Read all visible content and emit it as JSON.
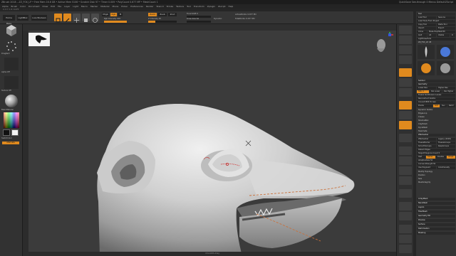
{
  "window": {
    "title": "ZBrush 2018   ...ZZ_FOX_LP   • Free Mem 16.6 GB • Active Mem 5106 • Scratch Disk 97 • Timer 0.009 • PolyCount 0.677 MP • MeshCount 1",
    "right_items": "QuickSave   See-through 0   Menus   DefaultZScript"
  },
  "menubar": [
    "Alpha",
    "Brush",
    "Color",
    "Document",
    "Draw",
    "Edit",
    "File",
    "Layer",
    "Light",
    "Macro",
    "Marker",
    "Material",
    "Movie",
    "Picker",
    "Preferences",
    "Render",
    "Stencil",
    "Stroke",
    "Texture",
    "Tool",
    "Transform",
    "Zplugin",
    "Zscript",
    "Help"
  ],
  "status_line": "X: 0 Y: 1   Z: 0.475",
  "shelf": {
    "home_page": "Home Page",
    "lightbox": "LightBox",
    "live_boolean": "Live Boolean",
    "edit": "Edit",
    "draw": "Draw",
    "move": "Move",
    "scale": "Scale",
    "rotate": "Rotate",
    "mrgb": "Mrgb",
    "rgb": "Rgb",
    "m": "M",
    "zadd": "Zadd",
    "zsub": "Zsub",
    "zcut": "Zcut",
    "rgb_intensity": "Rgb Intensity 100",
    "z_intensity": "Z Intensity 25",
    "rgb_intensity_value": 1.0,
    "z_intensity_value": 0.25,
    "focal_shift": "Focal Shift 0",
    "draw_size": "Draw Size 64",
    "dynamic": "Dynamic",
    "active_points": "ActivePoints: 0.677 Mil",
    "total_points": "TotalPoints: 0.677 Mil"
  },
  "left_tray": {
    "alpha_label": "Alpha Off",
    "texture_label": "Texture Off",
    "material_label": "BasicMaterial",
    "stroke_label": "DragRect",
    "gradient_label": "Gradient",
    "switch_color": "SwitchColor",
    "alternate": "Alternate"
  },
  "canvas": {
    "bottom_hint": "Ctrl+Shift+Drag"
  },
  "right_shelf": [
    "BPR",
    "SPix 3",
    "Scroll",
    "Zoom",
    "Actual",
    "AAHalf",
    "Persp",
    "Floor",
    "Local",
    "LSym",
    "Xyz",
    "Frame",
    "Move",
    "Scale",
    "Rotate",
    "Line Fill",
    "PolyF",
    "Transp",
    "Ghost",
    "Solo",
    "Xpose"
  ],
  "tool_tray": {
    "header": "Tool",
    "load_tool": "Load Tool",
    "save_as": "Save As",
    "load_tools_from_project": "Load Tools From Project",
    "copy_tool": "Copy Tool",
    "paste_tool": "Paste Tool",
    "import": "Import",
    "export": "Export",
    "clone": "Clone",
    "make_polymesh3d": "Make PolyMesh3D",
    "goz": "GoZ",
    "all": "All",
    "visible": "Visible",
    "r": "R",
    "lightbox_tools": "Lightbox▸Tools",
    "tool_name": "ZZ_FOX_LP. 48",
    "subtool": "Subtool",
    "geometry": "Geometry",
    "lower_res": "Lower Res",
    "higher_res": "Higher Res",
    "sdiv": "SDiv 1",
    "del_lower": "Del Lower",
    "del_higher": "Del Higher",
    "freeze_subdivision": "Freeze SubDivision Levels",
    "reconstruct_subdiv": "Reconstruct Subdiv",
    "convert_bpr": "Convert BPR To Geo",
    "divide": "Divide",
    "smt": "Smt",
    "suv": "Suv",
    "reuv": "ReUV",
    "dynamic_subdiv": "Dynamic Subdiv",
    "edgeloop": "EdgeLoop",
    "crease": "Crease",
    "shadowbox": "ShadowBox",
    "claypolish": "ClayPolish",
    "dynamesh": "DynaMesh",
    "tessimate": "Tessimate",
    "zremesher": "ZRemesher",
    "zremesher_btn": "ZRemesher",
    "legacy": "Legacy (2018)",
    "freeze_border": "FreezeBorder",
    "freeze_groups": "FreezeGroups",
    "smooth_groups": "SmoothGroups",
    "keep_groups": "KeepGroups",
    "detect_edges": "Detect Edges",
    "target_polygons": "Target Polygons Count 5",
    "half": "Half",
    "same": "Same",
    "double": "Double",
    "adapt": "Adapt",
    "adaptive_size": "AdaptiveSize 50",
    "curves_strength": "Curves Strength 50",
    "use_polypaint": "Use Polypaint",
    "color_density": "ColorDensity",
    "modify_topology": "Modify Topology",
    "position": "Position",
    "size": "Size",
    "meshintegrity": "MeshIntegrity",
    "arraymesh": "ArrayMesh",
    "nanomesh": "NanoMesh",
    "layers": "Layers",
    "fibermesh": "FiberMesh",
    "geometry_hd": "Geometry HD",
    "preview": "Preview",
    "surface": "Surface",
    "deformation": "Deformation",
    "masking": "Masking"
  },
  "colors": {
    "accent": "#e08a1e",
    "panel": "#343434",
    "canvas": "#3b3b3b",
    "curve_stroke": "#c9703a"
  }
}
